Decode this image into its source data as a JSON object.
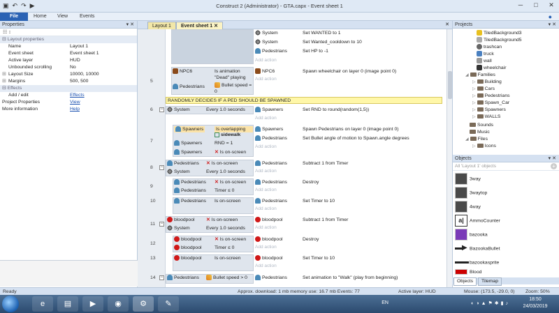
{
  "window": {
    "title": "Construct 2 (Administrator) - GTA.capx - Event sheet 1"
  },
  "ribbon": {
    "tabs": [
      "File",
      "Home",
      "View",
      "Events"
    ]
  },
  "properties": {
    "header": "Properties",
    "category1": "Layout properties",
    "rows": [
      {
        "key": "Name",
        "value": "Layout 1"
      },
      {
        "key": "Event sheet",
        "value": "Event sheet 1"
      },
      {
        "key": "Active layer",
        "value": "HUD"
      },
      {
        "key": "Unbounded scrolling",
        "value": "No"
      },
      {
        "key": "Layout Size",
        "value": "10000, 10000"
      },
      {
        "key": "Margins",
        "value": "500, 500"
      }
    ],
    "category2": "Effects",
    "effects_key": "Add / edit",
    "effects_link": "Effects",
    "project_key": "Project Properties",
    "project_link": "View",
    "more_key": "More information",
    "more_link": "Help"
  },
  "doctabs": [
    "Layout 1",
    "Event sheet 1"
  ],
  "events": {
    "system": "System",
    "pedestrians": "Pedestrians",
    "spawners": "Spawners",
    "bloodpool": "bloodpool",
    "npc6": "NPC6",
    "add_action": "Add action",
    "a_wanted": "Set WANTED to 1",
    "a_cooldown": "Set Wanted_cooldown to 10",
    "a_hp": "Set HP to -1",
    "c5_anim": "Is animation \"Dead\" playing",
    "c5_bullet": "Bullet speed = 0",
    "a5_spawn": "Spawn wheelchair on layer 0 (image point 0)",
    "comment": "RANDOMLY DECIDES IF A PED SHOULD BE SPAWNED",
    "every1": "Every 1.0 seconds",
    "a6_rnd": "Set RND to round(random(1,5))",
    "c7_overlap": "Is overlapping",
    "c7_sidewalk": "sidewalk",
    "c7_rnd": "RND = 1",
    "onscreen": "Is on-screen",
    "a7_spawn": "Spawn Pedestrians on layer 0 (image point 0)",
    "a7_angle": "Set Bullet angle of motion to Spawn.angle degrees",
    "sub_timer": "Subtract 1 from Timer",
    "timer_le0": "Timer ≤ 0",
    "destroy": "Destroy",
    "set_timer": "Set Timer to 10",
    "c14_bullet": "Bullet speed > 0",
    "a14_anim": "Set animation to \"Walk\" (play from beginning)",
    "rows": [
      "5",
      "6",
      "7",
      "8",
      "9",
      "10",
      "11",
      "12",
      "13",
      "14"
    ]
  },
  "projects": {
    "header": "Projects",
    "items": [
      "TiledBackground3",
      "TiledBackground5",
      "trashcan",
      "truck",
      "wall",
      "wheelchair"
    ],
    "families": "Families",
    "family_items": [
      "Building",
      "Cars",
      "Pedestrians",
      "Spawn_Car",
      "Spawners",
      "WALLS"
    ],
    "sounds": "Sounds",
    "music": "Music",
    "files": "Files",
    "icons": "Icons"
  },
  "objects": {
    "header": "Objects",
    "filter": "All 'Layout 1' objects",
    "items": [
      "3way",
      "3waytop",
      "4way",
      "AmmoCounter",
      "bazooka",
      "BazookaBullet",
      "bazookasprite",
      "Blood"
    ],
    "tabs": [
      "Objects",
      "Tilemap"
    ]
  },
  "status": {
    "ready": "Ready",
    "download": "Approx. download: 1 mb  memory use: 16.7 mb  Events: 77",
    "layer": "Active layer: HUD",
    "mouse": "Mouse: (173.5, -29.0, 0)",
    "zoom": "Zoom: 50%"
  },
  "taskbar": {
    "lang": "EN",
    "time": "18:50",
    "date": "24/03/2019"
  }
}
